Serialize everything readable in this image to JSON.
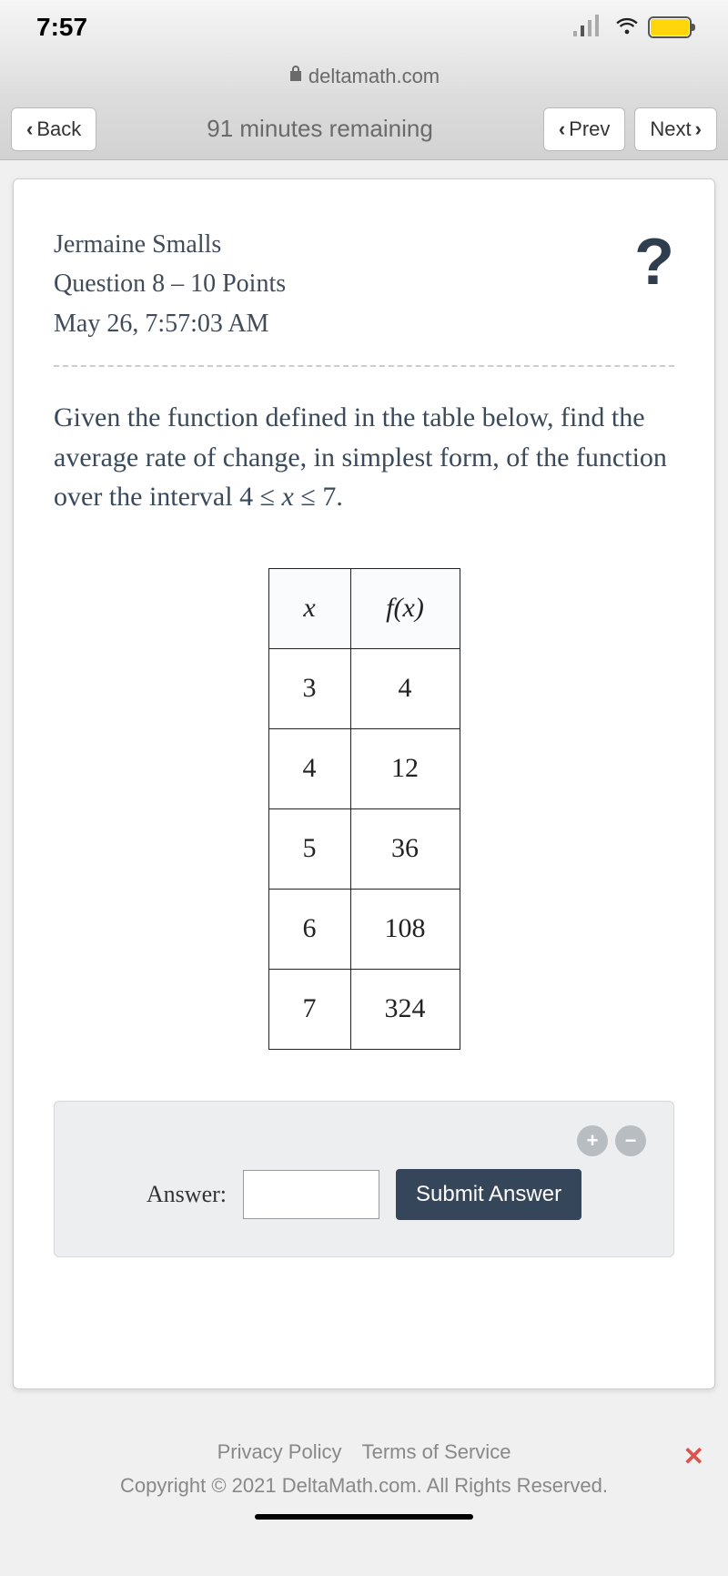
{
  "status": {
    "time": "7:57"
  },
  "address": {
    "url": "deltamath.com"
  },
  "nav": {
    "back_label": "Back",
    "prev_label": "Prev",
    "next_label": "Next",
    "timer_text": "91 minutes remaining"
  },
  "header": {
    "student_name": "Jermaine Smalls",
    "question_line": "Question 8 – 10 Points",
    "timestamp": "May 26, 7:57:03 AM"
  },
  "question": {
    "text_pre": "Given the function defined in the table below, find the average rate of change, in simplest form, of the function over the interval 4 ≤ ",
    "var": "x",
    "text_post": " ≤ 7."
  },
  "chart_data": {
    "type": "table",
    "columns": [
      "x",
      "f(x)"
    ],
    "rows": [
      {
        "x": "3",
        "fx": "4"
      },
      {
        "x": "4",
        "fx": "12"
      },
      {
        "x": "5",
        "fx": "36"
      },
      {
        "x": "6",
        "fx": "108"
      },
      {
        "x": "7",
        "fx": "324"
      }
    ]
  },
  "answer": {
    "label": "Answer:",
    "submit_label": "Submit Answer"
  },
  "footer": {
    "privacy": "Privacy Policy",
    "terms": "Terms of Service",
    "copyright": "Copyright © 2021 DeltaMath.com. All Rights Reserved."
  }
}
